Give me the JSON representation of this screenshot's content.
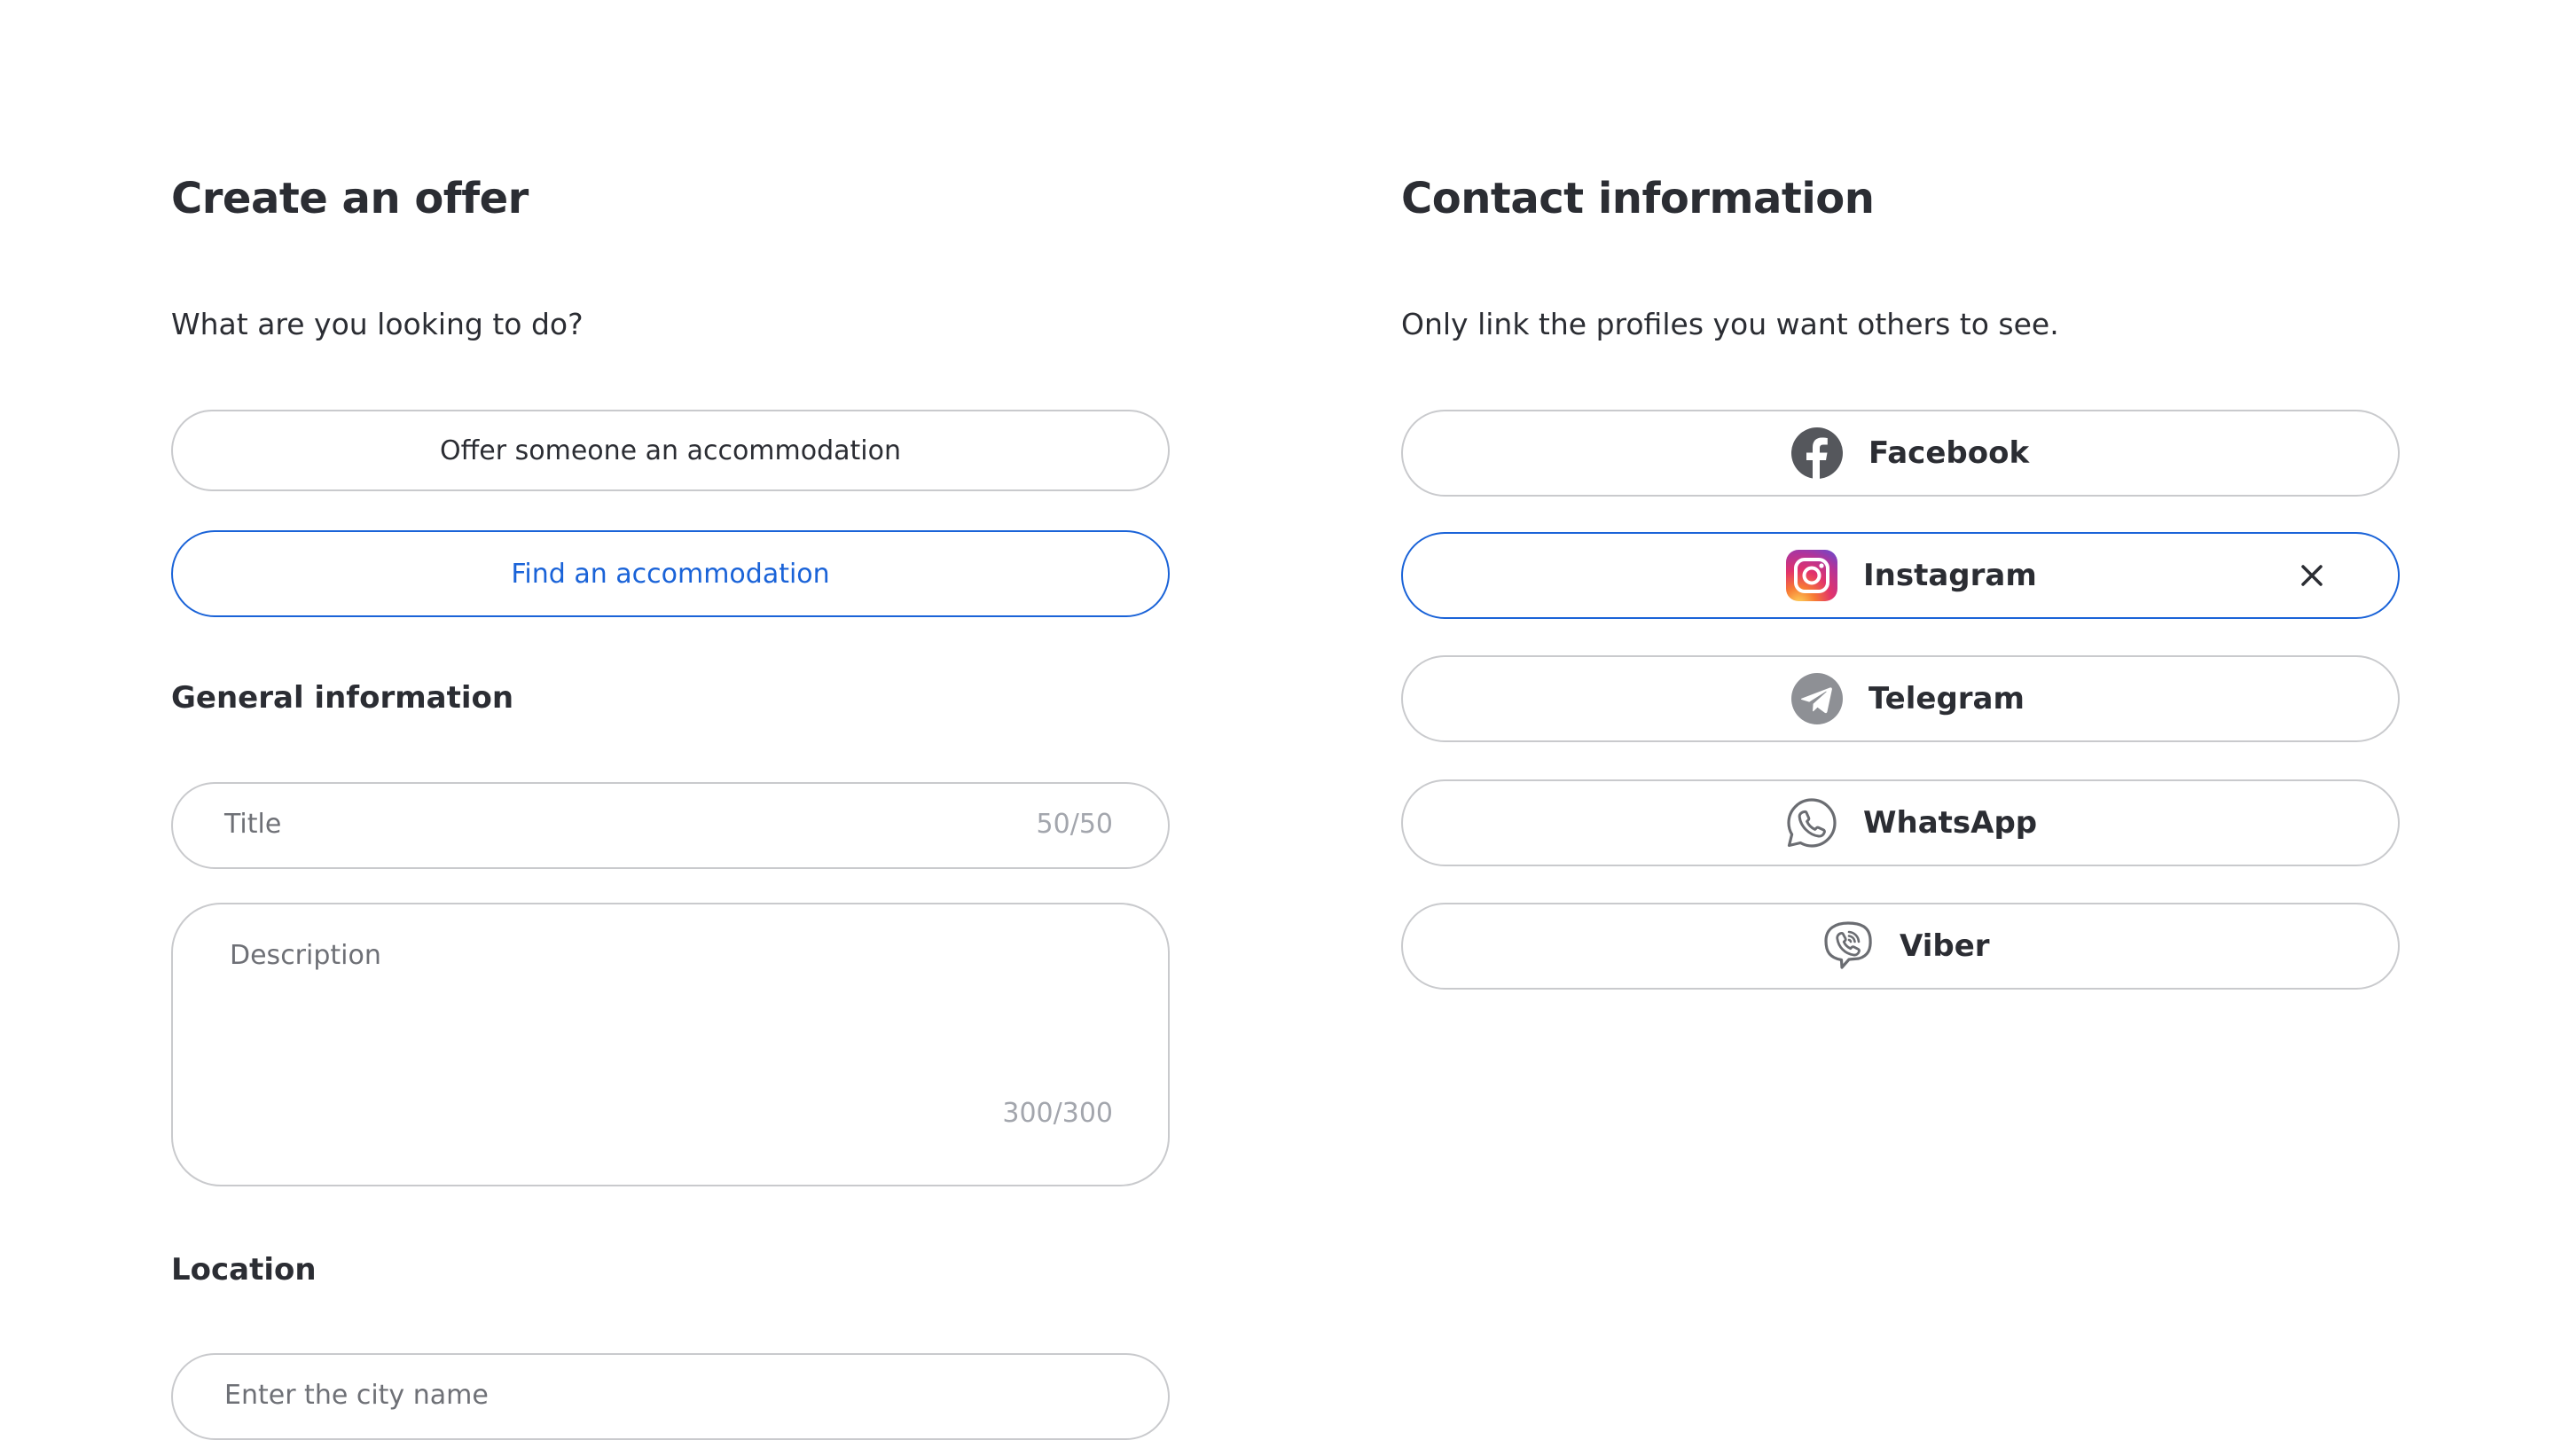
{
  "offer": {
    "heading": "Create an offer",
    "question": "What are you looking to do?",
    "options": [
      {
        "label": "Offer someone an accommodation",
        "selected": false
      },
      {
        "label": "Find an accommodation",
        "selected": true
      }
    ],
    "general_heading": "General information",
    "title_field": {
      "placeholder": "Title",
      "counter": "50/50"
    },
    "description_field": {
      "placeholder": "Description",
      "counter": "300/300"
    },
    "location_heading": "Location",
    "city_field": {
      "placeholder": "Enter the city name"
    }
  },
  "contact": {
    "heading": "Contact information",
    "subtitle": "Only link the profiles you want others to see.",
    "profiles": [
      {
        "label": "Facebook",
        "icon": "facebook-icon",
        "selected": false
      },
      {
        "label": "Instagram",
        "icon": "instagram-icon",
        "selected": true
      },
      {
        "label": "Telegram",
        "icon": "telegram-icon",
        "selected": false
      },
      {
        "label": "WhatsApp",
        "icon": "whatsapp-icon",
        "selected": false
      },
      {
        "label": "Viber",
        "icon": "viber-icon",
        "selected": false
      }
    ]
  },
  "colors": {
    "accent": "#1a63d8",
    "border": "#c9cacd",
    "text": "#2b2d33",
    "placeholder": "#6e7076",
    "counter": "#a3a6ad"
  }
}
